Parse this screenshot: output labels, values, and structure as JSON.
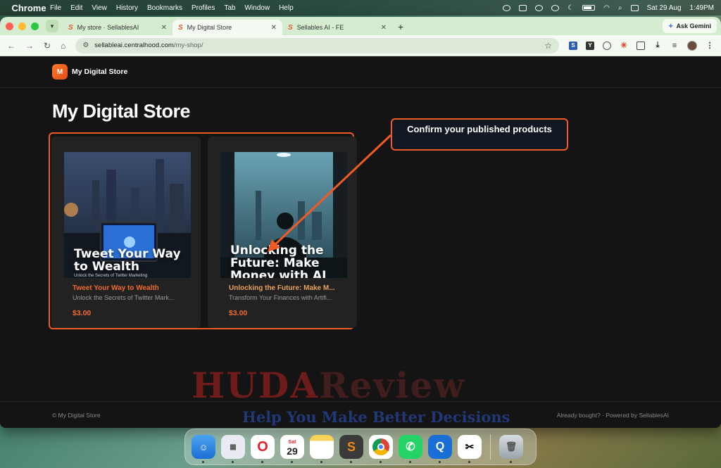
{
  "menubar": {
    "app_name": "Chrome",
    "menus": [
      "File",
      "Edit",
      "View",
      "History",
      "Bookmarks",
      "Profiles",
      "Tab",
      "Window",
      "Help"
    ],
    "date": "Sat 29 Aug",
    "time": "1:49PM"
  },
  "tabs": [
    {
      "title": "My store · SellablesAI",
      "active": false
    },
    {
      "title": "My Digital Store",
      "active": true
    },
    {
      "title": "Sellables AI - FE",
      "active": false
    }
  ],
  "ask_gemini": "Ask Gemini",
  "url": {
    "host": "sellableai.centralhood.com",
    "path": "/my-shop/"
  },
  "site": {
    "logo_letter": "M",
    "name": "My Digital Store",
    "page_title": "My Digital Store",
    "accent": "#f05a24"
  },
  "products": [
    {
      "thumb_title": "Tweet Your Way to Wealth",
      "thumb_subtitle": "Unlock the Secrets of Twitter Marketing",
      "name": "Tweet Your Way to Wealth",
      "description": "Unlock the Secrets of Twitter Mark...",
      "price": "$3.00"
    },
    {
      "thumb_title": "Unlocking the Future: Make Money with AI",
      "name": "Unlocking the Future: Make M...",
      "description": "Transform Your Finances with Artifi...",
      "price": "$3.00"
    }
  ],
  "callout": "Confirm your published products",
  "footer": {
    "left": "© My Digital Store",
    "right": "Already bought? · Powered by SellablesAI"
  },
  "watermark": {
    "main_a": "HUDA",
    "main_b": "Review",
    "tagline": "Help You Make Better Decisions"
  },
  "dock": {
    "calendar_month": "Sat",
    "calendar_day": "29",
    "apps": [
      "finder-icon",
      "launchpad-icon",
      "opera-icon",
      "calendar-icon",
      "notes-icon",
      "sublime-text-icon",
      "chrome-icon",
      "whatsapp-icon",
      "quicktime-icon",
      "capcut-icon",
      "trash-icon"
    ]
  }
}
